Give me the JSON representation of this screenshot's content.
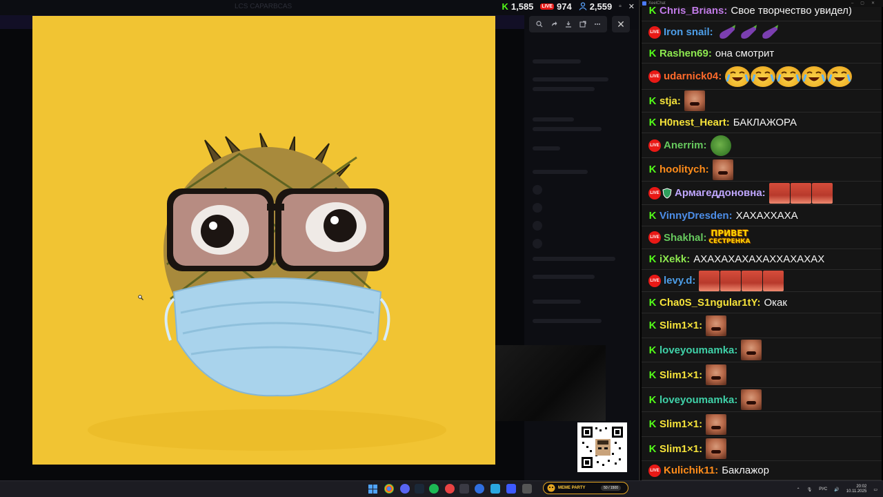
{
  "stream_overlay": {
    "stats": {
      "kick_viewers": "1,585",
      "live_viewers": "974",
      "total_viewers": "2,559"
    },
    "ghost_window_title": "LCS CAPARBCAS"
  },
  "image_viewer": {
    "toolbar_buttons": [
      "zoom-in",
      "share",
      "download",
      "open-external",
      "more"
    ],
    "close_label": "✕"
  },
  "chat": {
    "app_name": "XeelChat",
    "messages": [
      {
        "badges": [
          "kick"
        ],
        "user": "Chris_Brians:",
        "color": "#c07ae6",
        "text": "Свое творчество увидел)",
        "emotes": []
      },
      {
        "badges": [
          "live"
        ],
        "user": "Iron snail:",
        "color": "#4d9ee8",
        "text": "",
        "emotes": [
          "eggplant",
          "eggplant",
          "eggplant"
        ]
      },
      {
        "badges": [
          "kick"
        ],
        "user": "Rashen69:",
        "color": "#8de84f",
        "text": "она смотрит",
        "emotes": []
      },
      {
        "badges": [
          "live"
        ],
        "user": "udarnick04:",
        "color": "#ff6a2b",
        "text": "",
        "emotes": [
          "laugh",
          "laugh",
          "laugh",
          "laugh",
          "laugh"
        ]
      },
      {
        "badges": [
          "kick"
        ],
        "user": "stja:",
        "color": "#f5e23a",
        "text": "",
        "emotes": [
          "face"
        ]
      },
      {
        "badges": [
          "kick"
        ],
        "user": "H0nest_Heart:",
        "color": "#f5e23a",
        "text": "БАКЛАЖОРА",
        "emotes": []
      },
      {
        "badges": [
          "live"
        ],
        "user": "Anerrim:",
        "color": "#67c95e",
        "text": "",
        "emotes": [
          "pepe"
        ]
      },
      {
        "badges": [
          "kick"
        ],
        "user": "hoolitych:",
        "color": "#ff8c1a",
        "text": "",
        "emotes": [
          "face"
        ]
      },
      {
        "badges": [
          "live",
          "shield"
        ],
        "user": "Армагеддоновна:",
        "color": "#c0a7ff",
        "text": "",
        "emotes": [
          "face-wide",
          "face-wide",
          "face-wide"
        ]
      },
      {
        "badges": [
          "kick"
        ],
        "user": "VinnyDresden:",
        "color": "#4d8ee8",
        "text": "ХАХАХХАХА",
        "emotes": []
      },
      {
        "badges": [
          "live"
        ],
        "user": "Shakhal:",
        "color": "#67c95e",
        "text": "",
        "emotes": [
          "privet"
        ]
      },
      {
        "badges": [
          "kick"
        ],
        "user": "iXekk:",
        "color": "#8de84f",
        "text": "АХАХАХАХАХАХХАХАХАХ",
        "emotes": []
      },
      {
        "badges": [
          "live"
        ],
        "user": "levy.d:",
        "color": "#4d9ee8",
        "text": "",
        "emotes": [
          "face-wide",
          "face-wide",
          "face-wide",
          "face-wide"
        ]
      },
      {
        "badges": [
          "kick"
        ],
        "user": "Cha0S_S1ngular1tY:",
        "color": "#f5e23a",
        "text": "Окак",
        "emotes": []
      },
      {
        "badges": [
          "kick"
        ],
        "user": "Slim1×1:",
        "color": "#f5e23a",
        "text": "",
        "emotes": [
          "face"
        ]
      },
      {
        "badges": [
          "kick"
        ],
        "user": "loveyoumamka:",
        "color": "#3fd1a8",
        "text": "",
        "emotes": [
          "face"
        ]
      },
      {
        "badges": [
          "kick"
        ],
        "user": "Slim1×1:",
        "color": "#f5e23a",
        "text": "",
        "emotes": [
          "face"
        ]
      },
      {
        "badges": [
          "kick"
        ],
        "user": "loveyoumamka:",
        "color": "#3fd1a8",
        "text": "",
        "emotes": [
          "face"
        ]
      },
      {
        "badges": [
          "kick"
        ],
        "user": "Slim1×1:",
        "color": "#f5e23a",
        "text": "",
        "emotes": [
          "face"
        ]
      },
      {
        "badges": [
          "kick"
        ],
        "user": "Slim1×1:",
        "color": "#f5e23a",
        "text": "",
        "emotes": [
          "face"
        ]
      },
      {
        "badges": [
          "live"
        ],
        "user": "Kulichik11:",
        "color": "#ff8c1a",
        "text": "Баклажор",
        "emotes": []
      }
    ],
    "privet_emote": [
      "ПРИВЕТ",
      "СЕСТРЕНКА"
    ]
  },
  "taskbar": {
    "meme_party_title": "MEME PARTY",
    "meme_party_count": "50 / 1500",
    "language": "РУС",
    "time": "20:02",
    "date": "10.11.2025"
  }
}
